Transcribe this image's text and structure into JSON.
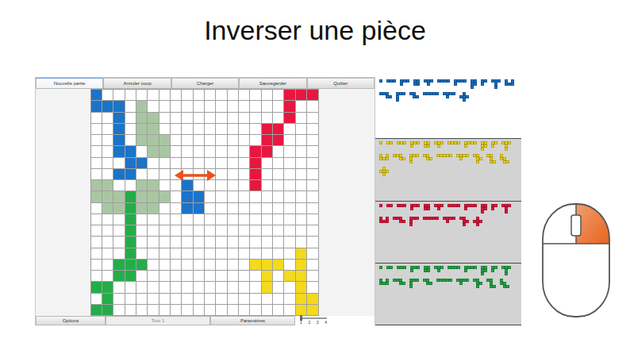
{
  "slide": {
    "title": "Inverser une pièce"
  },
  "toolbar": [
    {
      "label": "Nouvelle partie",
      "selected": true
    },
    {
      "label": "Annuler coup",
      "selected": false
    },
    {
      "label": "Charger",
      "selected": false
    },
    {
      "label": "Sauvegarder",
      "selected": false
    },
    {
      "label": "Quitter",
      "selected": false
    }
  ],
  "board": {
    "legend": {
      ".": "#ffffff",
      "B": "#1b74c8",
      "g": "#a9c6a3",
      "G": "#23ad49",
      "R": "#e8173f",
      "Y": "#f3da1c"
    },
    "rows": [
      "B................RRR",
      "BBB.g............R..",
      "..B.gg...........R..",
      "..B.gg.........RR...",
      "..B.ggg........RR...",
      "..BB.gg.......RR....",
      "...BB.........R.....",
      "..BB..........R.....",
      "gg..gg..B.....R.....",
      "gggGggg.BB..........",
      ".ggGgg..BB..........",
      "...G................",
      "...G................",
      "...G................",
      "...G..............Y.",
      "..GGG.........YYY.Y.",
      "..GG...........Y.YY.",
      "GG.............Y..Y.",
      ".G................YY",
      "GG................YY"
    ]
  },
  "bottom_bar": {
    "buttons": [
      {
        "label": "Options",
        "disabled": false
      },
      {
        "label": "Tour 1",
        "disabled": true
      },
      {
        "label": "Paramètres",
        "disabled": false
      }
    ],
    "slider": {
      "ticks": [
        "1",
        "2",
        "3",
        "4"
      ],
      "level": 0
    }
  },
  "shapes": [
    "X",
    "XX",
    "XXX",
    "XX/X.",
    "XXXX",
    "XXX/X..",
    "XXX/.X.",
    "XX/XX",
    "XX./.XX",
    "XXXXX",
    "XXXX/X...",
    "XXX./..XX",
    "XX/XX/X.",
    "XXX/X../X..",
    "XXX/.X./.X.",
    "X.X/XXX",
    "X../XX./.XX",
    ".X./XXX/.X.",
    "XXXX/.X..",
    "XX./.XX/.X.",
    "XX./.X./.XX"
  ],
  "players": [
    {
      "color": "#1b74c8",
      "selected": true,
      "pieces": [
        0,
        2,
        5,
        7,
        6,
        4,
        10,
        12,
        3,
        14,
        15,
        11,
        13,
        8,
        9,
        18,
        17
      ]
    },
    {
      "color": "#f3da1c",
      "selected": false,
      "pieces": [
        0,
        1,
        2,
        5,
        7,
        6,
        4,
        10,
        12,
        3,
        14,
        15,
        11,
        13,
        8,
        9,
        18,
        19,
        20,
        16,
        17
      ]
    },
    {
      "color": "#e8173f",
      "selected": false,
      "pieces": [
        0,
        1,
        2,
        5,
        7,
        6,
        4,
        10,
        12,
        3,
        14,
        15,
        11,
        13,
        9,
        18,
        19,
        17
      ]
    },
    {
      "color": "#23ad49",
      "selected": false,
      "pieces": [
        0,
        1,
        2,
        5,
        7,
        6,
        4,
        10,
        12,
        3,
        14,
        15,
        11,
        13,
        8,
        9,
        18,
        19,
        20,
        16
      ]
    }
  ],
  "mouse": {
    "pressed_button": "right"
  }
}
